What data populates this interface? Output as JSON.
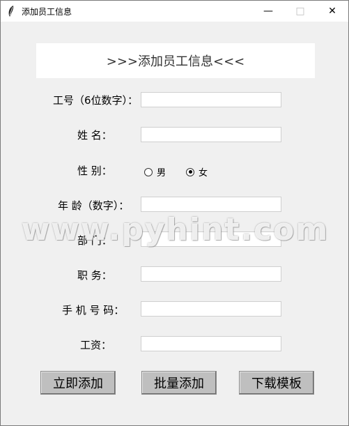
{
  "window": {
    "title": "添加员工信息",
    "controls": {
      "minimize": "—",
      "maximize": "□",
      "close": "✕"
    }
  },
  "banner": {
    "text": ">>>添加员工信息<<<"
  },
  "form": {
    "labels": {
      "emp_id": "工号（6位数字）：",
      "name": "姓 名：",
      "gender": "性 别：",
      "age": "年 龄（数字）：",
      "department": "部 门：",
      "position": "职 务：",
      "phone": "手 机 号 码：",
      "salary": "工资："
    },
    "values": {
      "emp_id": "",
      "name": "",
      "age": "",
      "department": "",
      "position": "",
      "phone": "",
      "salary": ""
    },
    "gender_options": [
      {
        "label": "男",
        "checked": false
      },
      {
        "label": "女",
        "checked": true
      }
    ]
  },
  "buttons": {
    "add_now": "立即添加",
    "batch_add": "批量添加",
    "download_template": "下载模板"
  },
  "watermark": "www.pyhint.com"
}
